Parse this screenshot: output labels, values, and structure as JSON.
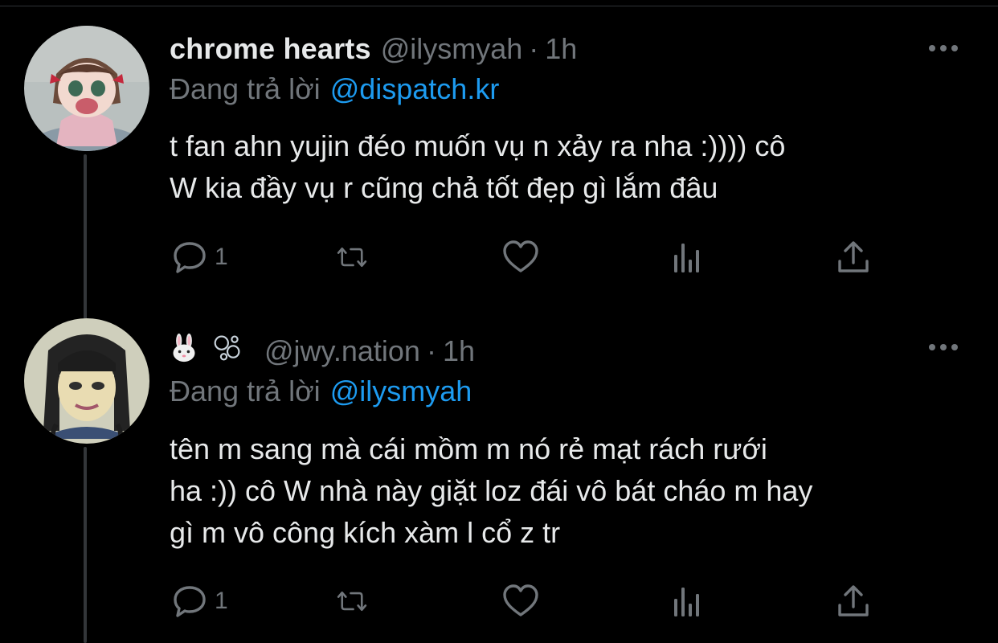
{
  "colors": {
    "background": "#000000",
    "text_primary": "#e7e9ea",
    "text_secondary": "#71767b",
    "link": "#1d9bf0"
  },
  "tweets": [
    {
      "author_name": "chrome hearts",
      "handle": "@ilysmyah",
      "separator": "·",
      "time": "1h",
      "reply_prefix": "Đang trả lời",
      "reply_to": "@dispatch.kr",
      "text_lines": [
        "t fan ahn yujin đéo muốn vụ n xảy ra nha :)))) cô",
        "W kia đầy vụ r cũng chả tốt đẹp gì lắm đâu"
      ],
      "reply_count": "1",
      "more_icon": "more-horizontal-icon"
    },
    {
      "author_name_icons": [
        "rabbit-emoji-icon",
        "bubbles-emoji-icon"
      ],
      "handle": "@jwy.nation",
      "separator": "·",
      "time": "1h",
      "reply_prefix": "Đang trả lời",
      "reply_to": "@ilysmyah",
      "text_lines": [
        "tên m sang mà cái mồm m nó rẻ mạt rách rưới",
        "ha :)) cô W nhà này giặt loz đái vô bát cháo m hay",
        "gì m vô công kích xàm l cổ z tr"
      ],
      "reply_count": "1",
      "more_icon": "more-horizontal-icon"
    }
  ],
  "action_icons": [
    "reply-icon",
    "retweet-icon",
    "like-icon",
    "analytics-icon",
    "share-icon"
  ]
}
